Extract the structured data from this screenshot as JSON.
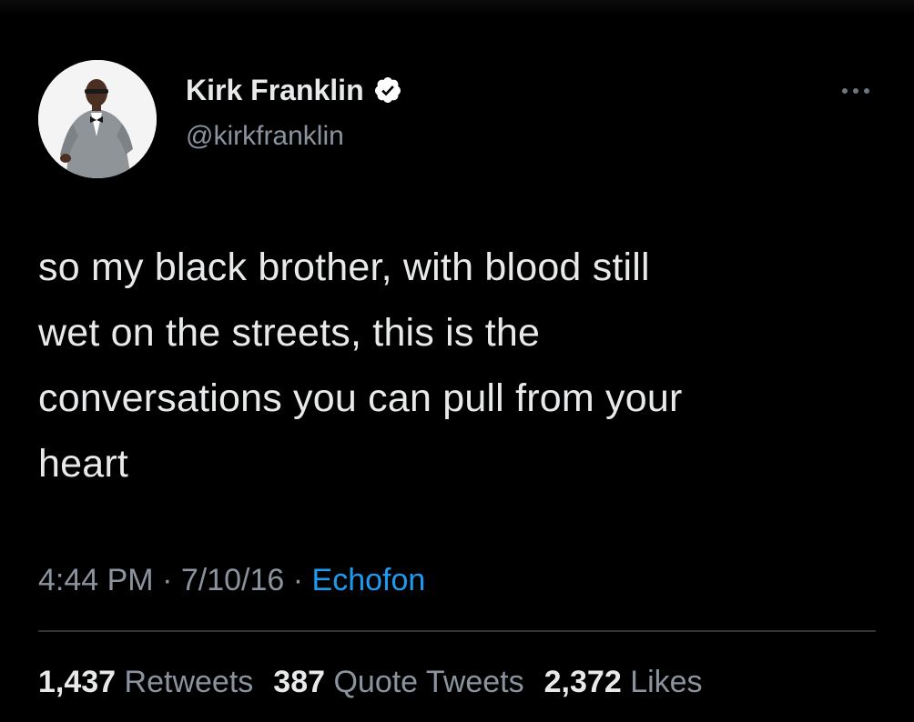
{
  "author": {
    "display_name": "Kirk Franklin",
    "handle": "@kirkfranklin",
    "verified": true,
    "avatar_icon": "user-avatar-photo"
  },
  "menu": {
    "icon": "more-options-icon"
  },
  "tweet": {
    "text": "so my black brother, with blood still\nwet on the streets, this is the\nconversations you can pull from your\nheart"
  },
  "meta": {
    "time": "4:44 PM",
    "sep1": " · ",
    "date": "7/10/16",
    "sep2": " · ",
    "source": "Echofon"
  },
  "stats": {
    "retweets_count": "1,437",
    "retweets_label": "Retweets",
    "quotes_count": "387",
    "quotes_label": "Quote Tweets",
    "likes_count": "2,372",
    "likes_label": "Likes"
  },
  "colors": {
    "background": "#000000",
    "text_primary": "#e7e9ea",
    "text_secondary": "#8b949e",
    "link": "#1d9bf0",
    "divider": "#2f3336",
    "verified_badge": "#ffffff"
  }
}
